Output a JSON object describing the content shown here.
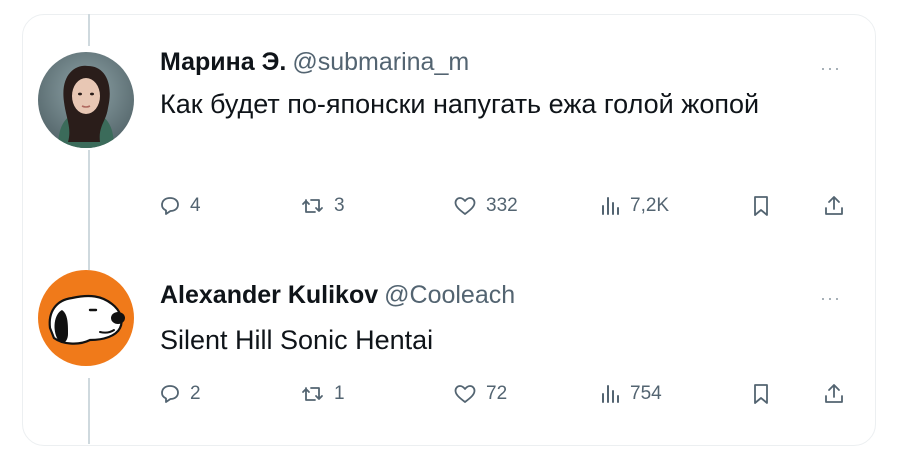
{
  "tweets": [
    {
      "name": "Марина Э.",
      "handle": "@submarina_m",
      "text": "Как будет по-японски напугать ежа голой жопой",
      "more": "···",
      "avatar": "woman-portrait-avatar",
      "stats": {
        "replies": "4",
        "reposts": "3",
        "likes": "332",
        "views": "7,2K"
      }
    },
    {
      "name": "Alexander Kulikov",
      "handle": "@Cooleach",
      "text": "Silent Hill Sonic Hentai",
      "more": "···",
      "avatar": "snoopy-avatar",
      "stats": {
        "replies": "2",
        "reposts": "1",
        "likes": "72",
        "views": "754"
      }
    }
  ],
  "colors": {
    "text": "#0f1419",
    "muted": "#536471",
    "thread_line": "#cfd9de",
    "snoopy_bg": "#f07a1a"
  },
  "icons": [
    "reply-icon",
    "repost-icon",
    "like-icon",
    "views-icon",
    "bookmark-icon",
    "share-icon",
    "more-icon"
  ]
}
